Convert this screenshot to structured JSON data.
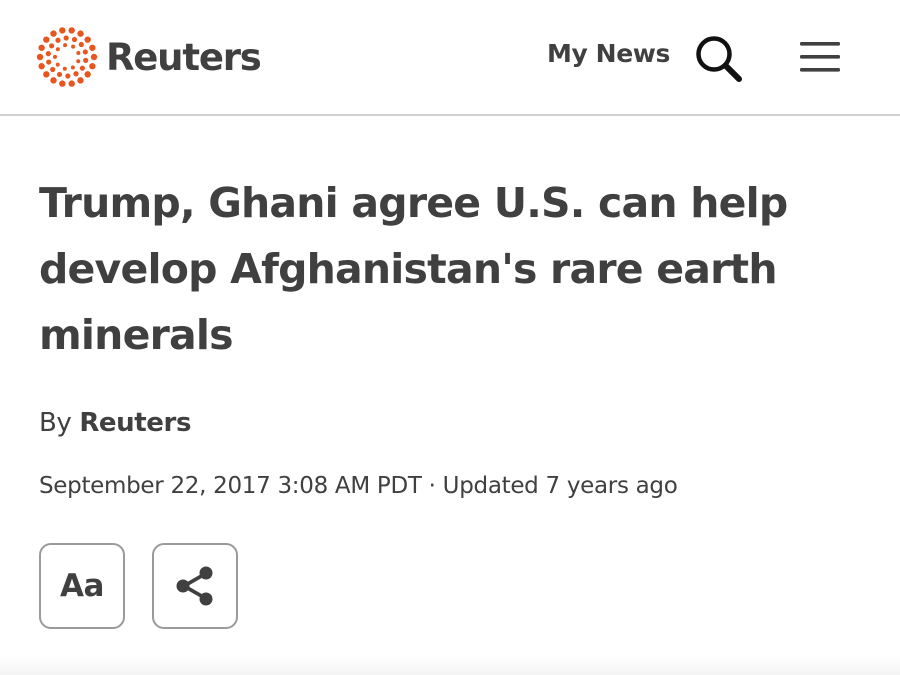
{
  "header": {
    "logo_text": "Reuters",
    "logo_icon": "reuters-dot-ring-logo",
    "my_news_label": "My News",
    "search_icon": "search-icon",
    "menu_icon": "hamburger-menu-icon"
  },
  "article": {
    "headline": "Trump, Ghani agree U.S. can help develop Afghanistan's rare earth minerals",
    "byline_prefix": "By",
    "byline_author": "Reuters",
    "dateline": "September 22, 2017 3:08 AM PDT · Updated 7 years ago"
  },
  "tools": {
    "font_size_label": "Aa",
    "share_icon": "share-icon"
  },
  "colors": {
    "brand_orange": "#E8561F",
    "text": "#404040",
    "divider": "#D0D0D0",
    "button_border": "#9A9A9A"
  }
}
